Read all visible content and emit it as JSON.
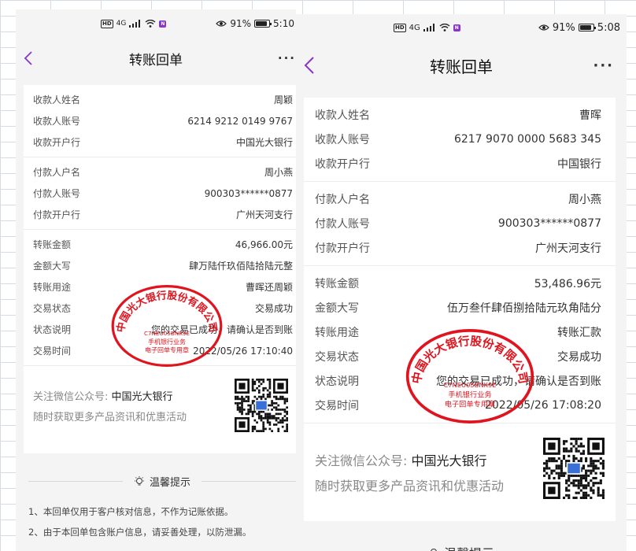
{
  "screens": [
    {
      "status": {
        "battery": "91%",
        "time": "5:10",
        "network": "4G",
        "battery_level": 0.91
      },
      "nav": {
        "title": "转账回单",
        "more": "···"
      },
      "payee": [
        {
          "k": "收款人姓名",
          "v": "周颖"
        },
        {
          "k": "收款人账号",
          "v": "6214 9212 0149 9767"
        },
        {
          "k": "收款开户行",
          "v": "中国光大银行"
        }
      ],
      "payer": [
        {
          "k": "付款人户名",
          "v": "周小燕"
        },
        {
          "k": "付款人账号",
          "v": "900303******0877"
        },
        {
          "k": "付款开户行",
          "v": "广州天河支行"
        }
      ],
      "details": [
        {
          "k": "转账金额",
          "v": "46,966.00元"
        },
        {
          "k": "金额大写",
          "v": "肆万陆仟玖佰陆拾陆元整"
        },
        {
          "k": "转账用途",
          "v": "曹晖还周颖"
        },
        {
          "k": "交易状态",
          "v": "交易成功"
        },
        {
          "k": "状态说明",
          "v": "您的交易已成功，请确认是否到账"
        },
        {
          "k": "交易时间",
          "v": "2022/05/26 17:10:40"
        }
      ],
      "promo": {
        "label": "关注微信公众号:",
        "name": "中国光大银行",
        "line2": "随时获取更多产品资讯和优惠活动"
      },
      "tips": {
        "title": "温馨提示",
        "items": [
          "1、本回单仅用于客户核对信息，不作为记账依据。",
          "2、由于本回单包含账户信息，请妥善处理，以防泄漏。"
        ]
      },
      "stamp": {
        "org": "中国光大银行股份有限公司",
        "code": "C7NEU05BNK9E",
        "line1": "手机银行业务",
        "line2": "电子回单专用章"
      }
    },
    {
      "status": {
        "battery": "91%",
        "time": "5:08",
        "network": "4G",
        "battery_level": 0.91
      },
      "nav": {
        "title": "转账回单",
        "more": "···"
      },
      "payee": [
        {
          "k": "收款人姓名",
          "v": "曹晖"
        },
        {
          "k": "收款人账号",
          "v": "6217 9070 0000 5683 345"
        },
        {
          "k": "收款开户行",
          "v": "中国银行"
        }
      ],
      "payer": [
        {
          "k": "付款人户名",
          "v": "周小燕"
        },
        {
          "k": "付款人账号",
          "v": "900303******0877"
        },
        {
          "k": "付款开户行",
          "v": "广州天河支行"
        }
      ],
      "details": [
        {
          "k": "转账金额",
          "v": "53,486.96元"
        },
        {
          "k": "金额大写",
          "v": "伍万叁仟肆佰捌拾陆元玖角陆分"
        },
        {
          "k": "转账用途",
          "v": "转账汇款"
        },
        {
          "k": "交易状态",
          "v": "交易成功"
        },
        {
          "k": "状态说明",
          "v": "您的交易已成功，请确认是否到账"
        },
        {
          "k": "交易时间",
          "v": "2022/05/26 17:08:20"
        }
      ],
      "promo": {
        "label": "关注微信公众号:",
        "name": "中国光大银行",
        "line2": "随时获取更多产品资讯和优惠活动"
      },
      "tips": {
        "title": "温馨提示"
      },
      "stamp": {
        "org": "中国光大银行股份有限公司",
        "code": "C7NEU05BNK9E",
        "line1": "手机银行业务",
        "line2": "电子回单专用章"
      }
    }
  ],
  "colors": {
    "accent": "#8a35c9",
    "stamp": "#e0141e"
  }
}
